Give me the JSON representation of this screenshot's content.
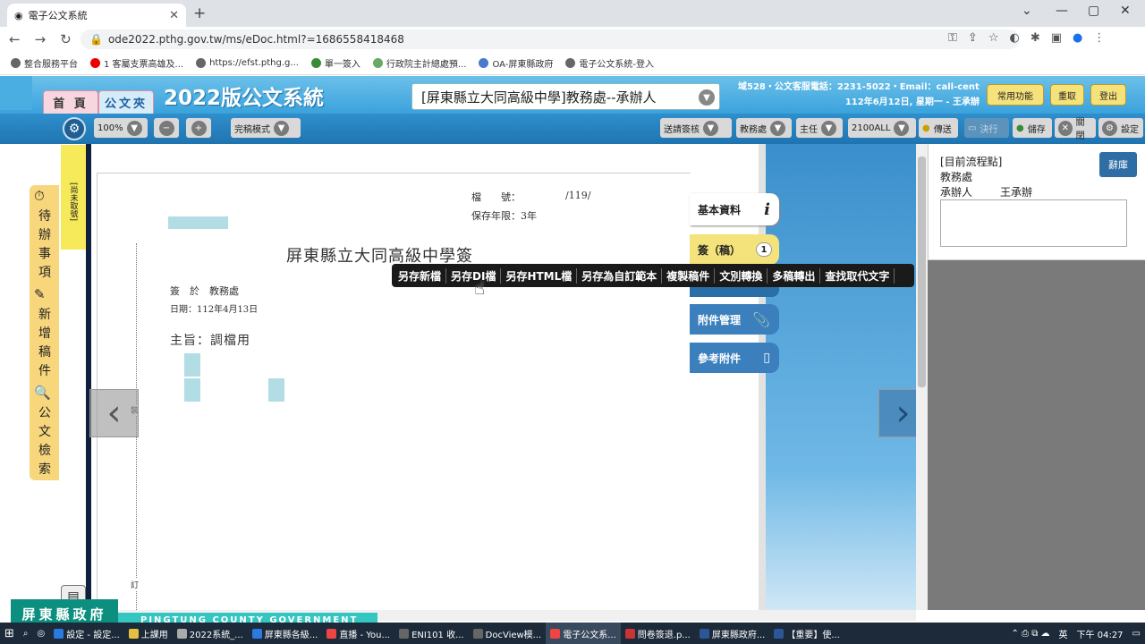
{
  "browser": {
    "tab_title": "電子公文系統",
    "url": "ode2022.pthg.gov.tw/ms/eDoc.html?=1686558418468",
    "bookmarks": [
      "整合服務平台",
      "1 客屬支票高雄及...",
      "https://efst.pthg.g...",
      "單一簽入",
      "行政院主計總處預...",
      "OA-屏東縣政府",
      "電子公文系統-登入"
    ]
  },
  "header": {
    "tab_home": "首 頁",
    "tab_folder": "公文夾",
    "title": "2022版公文系統",
    "org_select": "[屏東縣立大同高級中學]教務處--承辦人",
    "info_line1": "域528・公文客服電話：2231-5022・Email：call-center",
    "info_line2": "112年6月12日, 星期一 - 王承辦",
    "btn_common": "常用功能",
    "btn_reload": "重取",
    "btn_logout": "登出"
  },
  "toolbar": {
    "zoom": "100%",
    "mode": "完稿模式",
    "send_review": "送請簽核",
    "dept": "教務處",
    "role": "主任",
    "code": "2100ALL",
    "send": "傳送",
    "execute": "決行",
    "save": "儲存",
    "close": "關閉",
    "settings": "設定"
  },
  "sidebar": {
    "sticky": "[尚未取號]",
    "todo": [
      "待",
      "辦",
      "事",
      "項"
    ],
    "new_draft": [
      "新",
      "增",
      "稿",
      "件"
    ],
    "search": [
      "公",
      "文",
      "檢",
      "索"
    ]
  },
  "document": {
    "file_no_label": "檔　　號：",
    "file_no_value": "/119/",
    "retention": "保存年限：3年",
    "title": "屏東縣立大同高級中學簽",
    "at": "簽　於　教務處",
    "date": "日期：112年4月13日",
    "subject": "主旨：調檔用",
    "margin_mark1": "裝",
    "margin_mark2": "訂"
  },
  "right_tabs": {
    "basic": "基本資料",
    "draft": "簽（稿）",
    "draft_count": "1",
    "attachments": "附件管理",
    "reference": "參考附件"
  },
  "context_menu": [
    "另存新檔",
    "另存DI檔",
    "另存HTML檔",
    "另存為自訂範本",
    "複製稿件",
    "文別轉換",
    "多稿轉出",
    "查找取代文字"
  ],
  "flow_panel": {
    "heading": "[目前流程點]",
    "dept": "教務處",
    "role": "承辦人",
    "person": "王承辦",
    "dismiss": "辭庫"
  },
  "footer": {
    "gov_name": "屏東縣政府",
    "gov_en": "PINGTUNG COUNTY GOVERNMENT"
  },
  "taskbar": {
    "items": [
      "設定 - 設定...",
      "上課用",
      "2022系統_...",
      "屏東縣各級...",
      "直播 - You...",
      "ENI101 收...",
      "DocView模...",
      "電子公文系...",
      "問卷簽退.p...",
      "屏東縣政府...",
      "【重要】使..."
    ],
    "ime": "英",
    "clock": "下午 04:27"
  }
}
